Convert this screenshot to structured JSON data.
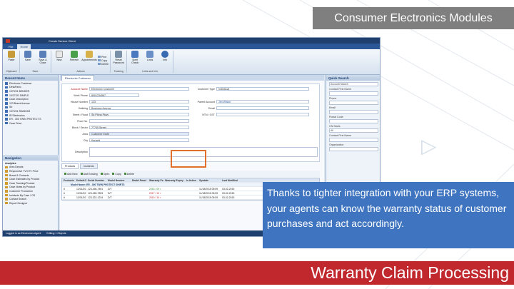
{
  "slide": {
    "banner_title": "Consumer Electronics Modules",
    "callout_text": "Thanks to tighter integration with your ERP systems, your agents can know the warranty status of customer purchases and act accordingly.",
    "bottom_title": "Warranty Claim Processing",
    "colors": {
      "banner": "#7f7f7f",
      "callout": "#3f74c0",
      "bottom_bar": "#c0282e",
      "highlight_box": "#e0702a"
    }
  },
  "app": {
    "title": "Create Service Client",
    "tabs": [
      "File",
      "Home"
    ],
    "ribbon_groups": [
      {
        "label": "Clipboard",
        "buttons": [
          "Paste"
        ]
      },
      {
        "label": "Save",
        "buttons": [
          "Save",
          "Save & Close"
        ]
      },
      {
        "label": "Actions",
        "buttons": [
          "New",
          "Refresh",
          "Appointments"
        ],
        "mini": [
          "Print",
          "Copy",
          "Delete"
        ]
      },
      {
        "label": "Tracking",
        "buttons": [
          "Reset Password"
        ]
      },
      {
        "label": "Links and Info",
        "buttons": [
          "Spell Check",
          "Links",
          "Info"
        ]
      }
    ],
    "recent_items": {
      "header": "Recent Items",
      "items": [
        "Electronic Customer",
        "DeskPanic",
        "1970/01 BENDER",
        "10/27/20 SIMPLE",
        "Case Description",
        "123 Brand Avenue",
        "Sb",
        "1970/01 RANDOM",
        "IR Electronics",
        "ER - 300 TWIN PROTECT S",
        "Case Drive"
      ]
    },
    "navigation": {
      "header": "Navigation",
      "sub": "Analytics",
      "items": [
        "Area Depots",
        "Responsive TV/CTV Price",
        "Brand & Contacts",
        "Case Estimates by Product",
        "Case Tracking/Product",
        "Case Notes by Product",
        "Customer Production",
        "Incidents By Case / OS",
        "Contact Search",
        "Report Designer"
      ]
    },
    "doc_tab": "Electronic Customer",
    "form": {
      "account_label": "Account Name",
      "account_value": "Electronic Customer",
      "phone_label": "Work Phone",
      "phone_value": "8001234567",
      "house_label": "House Number",
      "house_value": "123",
      "building_label": "Building",
      "building_value": "Business Avenue",
      "street_label": "Street / Road",
      "street_value": "Sb Phina Pkwy",
      "floor_label": "Floor No.",
      "floor_value": "",
      "block_label": "Block / Sector",
      "block_value": "77745 Street",
      "area_label": "Area",
      "area_value": "Customer Eight",
      "city_label": "City",
      "city_value": "Karachi",
      "desc_label": "Description",
      "desc_value": "",
      "ctype_label": "Customer Type",
      "ctype_value": "Individual",
      "parent_label": "Parent Account",
      "parent_value": "Jim Wilson",
      "email_label": "Email",
      "email_value": "",
      "vat_label": "NTN / GST",
      "vat_value": ""
    },
    "subtabs": [
      "Products",
      "Incidents"
    ],
    "product_toolbar": [
      "Add New",
      "Add Existing",
      "Open",
      "Copy",
      "Delete"
    ],
    "grid": {
      "columns": [
        "Products",
        "Default Pricing",
        "Serial Number",
        "Model Number",
        "Model Panel",
        "Warranty Period",
        "Warranty Expiry",
        "Is Active",
        "Sysdate",
        "Last Modified"
      ],
      "group_label": "Model Name: ER - 300 TWIN PROTECT SHIRTS",
      "rows": [
        [
          "6",
          "12/01/2015",
          "123-456-7891",
          "D/T",
          "",
          "2016 / 09 ▪",
          "",
          "",
          "11/18/2015 05:59",
          "03-02-2015"
        ],
        [
          "6",
          "12/01/2015",
          "123-455-7893",
          "D/T",
          "",
          "2017 / 10 ▪",
          "",
          "",
          "11/18/2015 05:59",
          "03-02-2015"
        ],
        [
          "6",
          "12/01/2015",
          "123-322-1234",
          "D/T",
          "",
          "2019 / 10 ▪",
          "",
          "",
          "11/18/2015 05:59",
          "03-02-2015"
        ]
      ]
    },
    "quick_search": {
      "header": "Quick Search",
      "dropdown": "Account Search",
      "fields": [
        {
          "label": "Contact First Name",
          "value": ""
        },
        {
          "label": "Phone",
          "value": ""
        },
        {
          "label": "Email",
          "value": ""
        },
        {
          "label": "Postal Code",
          "value": ""
        },
        {
          "label": "CN Starts",
          "value": "All"
        },
        {
          "label": "Contact First Name",
          "value": ""
        },
        {
          "label": "Organization",
          "value": ""
        }
      ]
    },
    "status_bar": [
      "Logged in as Electronics Agent",
      "Editing 1 Objects"
    ]
  }
}
